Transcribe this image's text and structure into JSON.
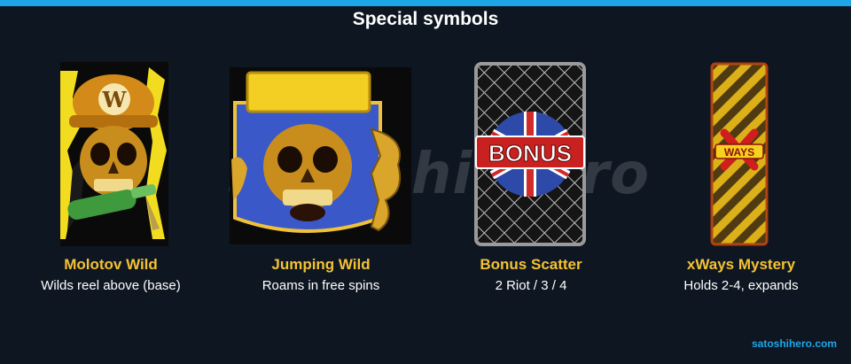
{
  "title": "Special symbols",
  "watermark": "Satoshi Hero",
  "symbols": [
    {
      "name": "Molotov Wild",
      "description": "Wilds reel above (base)",
      "badge": "W"
    },
    {
      "name": "Jumping Wild",
      "description": "Roams in free spins"
    },
    {
      "name": "Bonus Scatter",
      "description": "2 Riot / 3 / 4",
      "badge": "BONUS"
    },
    {
      "name": "xWays Mystery",
      "description": "Holds 2-4, expands",
      "badge": "WAYS"
    }
  ],
  "footer": "satoshihero.com",
  "colors": {
    "accent": "#1ea7e8",
    "name_gold": "#f4c233",
    "background": "#0e1621"
  }
}
